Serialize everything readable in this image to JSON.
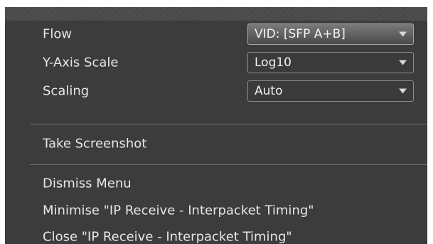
{
  "menu": {
    "settings": [
      {
        "label": "Flow",
        "value": "VID: [SFP A+B]",
        "highlighted": true
      },
      {
        "label": "Y-Axis Scale",
        "value": "Log10",
        "highlighted": false
      },
      {
        "label": "Scaling",
        "value": "Auto",
        "highlighted": false
      }
    ],
    "take_screenshot": "Take Screenshot",
    "dismiss_menu": "Dismiss Menu",
    "minimise": "Minimise \"IP Receive - Interpacket Timing\"",
    "close": "Close \"IP Receive - Interpacket Timing\""
  },
  "colors": {
    "panel_background": "#3c3c3c",
    "text": "#e6e6e6",
    "dropdown_border": "#8c8c8c",
    "divider": "#6e6e6e"
  }
}
